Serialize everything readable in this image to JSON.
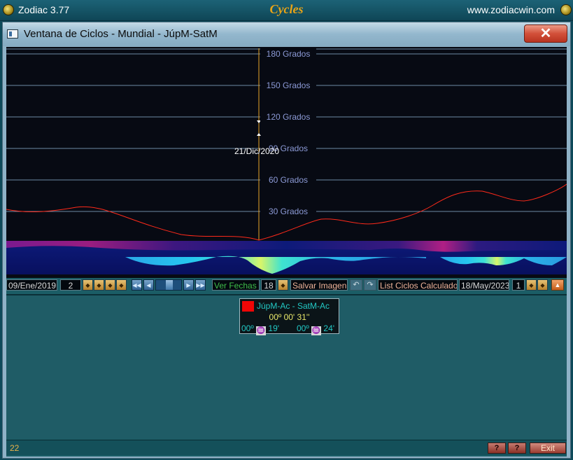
{
  "app": {
    "title": "Zodiac 3.77",
    "center_title": "Cycles",
    "url": "www.zodiacwin.com"
  },
  "window": {
    "title": "Ventana de Ciclos - Mundial - JúpM-SatM",
    "close_symbol": "✕"
  },
  "chart": {
    "grid_labels": [
      "180 Grados",
      "150 Grados",
      "120 Grados",
      "90 Grados",
      "60 Grados",
      "30 Grados"
    ],
    "cursor_date": "21/Dic/2020",
    "colors": {
      "background": "#070a13",
      "curve": "#ff2a1a",
      "cursor": "#e8a52a",
      "grid": "#6d8aa6",
      "label": "#8c9ad6"
    }
  },
  "toolbar": {
    "start_date": "09/Ene/2019",
    "step_value": "2",
    "view_dates_label": "Ver Fechas",
    "view_dates_value": "18",
    "save_image_label": "Salvar Imagen",
    "list_cycles_label": "List Ciclos Calculados",
    "end_date": "18/May/2023",
    "end_value": "1"
  },
  "info_box": {
    "title": "JúpM-Ac - SatM-Ac",
    "value": "00º 00' 31''",
    "left_pos": {
      "deg": "00º",
      "min": "19'"
    },
    "right_pos": {
      "deg": "00º",
      "min": "24'"
    },
    "swatch_color": "#ef0606",
    "sign_glyph": "♒"
  },
  "status": {
    "value": "22",
    "help1": "?",
    "help2": "?",
    "exit_label": "Exit"
  }
}
